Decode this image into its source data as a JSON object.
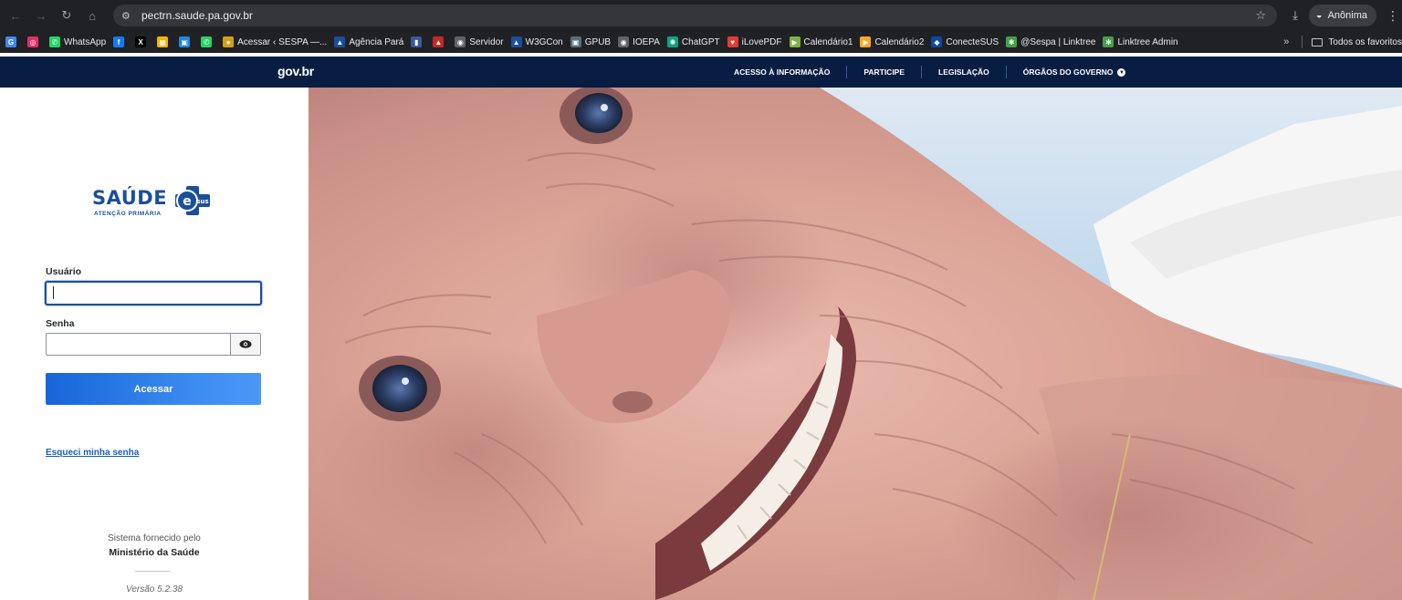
{
  "browser": {
    "url": "pectrn.saude.pa.gov.br",
    "profile_label": "Anônima",
    "bookmarks": [
      {
        "label": "",
        "color": "#4285f4",
        "glyph": "G"
      },
      {
        "label": "",
        "color": "#e1306c",
        "glyph": "◎"
      },
      {
        "label": "WhatsApp",
        "color": "#25d366",
        "glyph": "✆"
      },
      {
        "label": "",
        "color": "#1877f2",
        "glyph": "f"
      },
      {
        "label": "",
        "color": "#000000",
        "glyph": "X"
      },
      {
        "label": "",
        "color": "#f4b400",
        "glyph": "▦"
      },
      {
        "label": "",
        "color": "#1e88e5",
        "glyph": "▣"
      },
      {
        "label": "",
        "color": "#25d366",
        "glyph": "✆"
      },
      {
        "label": "Acessar ‹ SESPA —...",
        "color": "#d4a017",
        "glyph": "●"
      },
      {
        "label": "Agência Pará",
        "color": "#1a4f9c",
        "glyph": "▲"
      },
      {
        "label": "",
        "color": "#3b5998",
        "glyph": "▮"
      },
      {
        "label": "",
        "color": "#c62828",
        "glyph": "▲"
      },
      {
        "label": "Servidor",
        "color": "#5f6368",
        "glyph": "◉"
      },
      {
        "label": "W3GCon",
        "color": "#1a4f9c",
        "glyph": "▲"
      },
      {
        "label": "GPUB",
        "color": "#546e7a",
        "glyph": "▣"
      },
      {
        "label": "IOEPA",
        "color": "#5f6368",
        "glyph": "◉"
      },
      {
        "label": "ChatGPT",
        "color": "#10a37f",
        "glyph": "✺"
      },
      {
        "label": "iLovePDF",
        "color": "#e53935",
        "glyph": "♥"
      },
      {
        "label": "Calendário1",
        "color": "#7cb342",
        "glyph": "▶"
      },
      {
        "label": "Calendário2",
        "color": "#f9a825",
        "glyph": "▶"
      },
      {
        "label": "ConecteSUS",
        "color": "#0d47a1",
        "glyph": "◆"
      },
      {
        "label": "@Sespa | Linktree",
        "color": "#43a047",
        "glyph": "✱"
      },
      {
        "label": "Linktree Admin",
        "color": "#43a047",
        "glyph": "✱"
      }
    ],
    "all_bookmarks_label": "Todos os favoritos"
  },
  "govbar": {
    "logo": "gov.br",
    "links": [
      "ACESSO À INFORMAÇÃO",
      "PARTICIPE",
      "LEGISLAÇÃO",
      "ÓRGÃOS DO GOVERNO"
    ]
  },
  "login": {
    "logo_word": "SAÚDE",
    "logo_badge": "sus",
    "logo_subtitle": "ATENÇÃO PRIMÁRIA",
    "user_label": "Usuário",
    "user_value": "",
    "password_label": "Senha",
    "password_value": "",
    "submit_label": "Acessar",
    "forgot_label": "Esqueci minha senha"
  },
  "footer": {
    "provided_by": "Sistema fornecido pelo",
    "ministry": "Ministério da Saúde",
    "version": "Versão 5.2.38"
  },
  "colors": {
    "gov_navy": "#071d41",
    "primary_blue": "#1765d8",
    "logo_blue": "#1a4f9c"
  }
}
